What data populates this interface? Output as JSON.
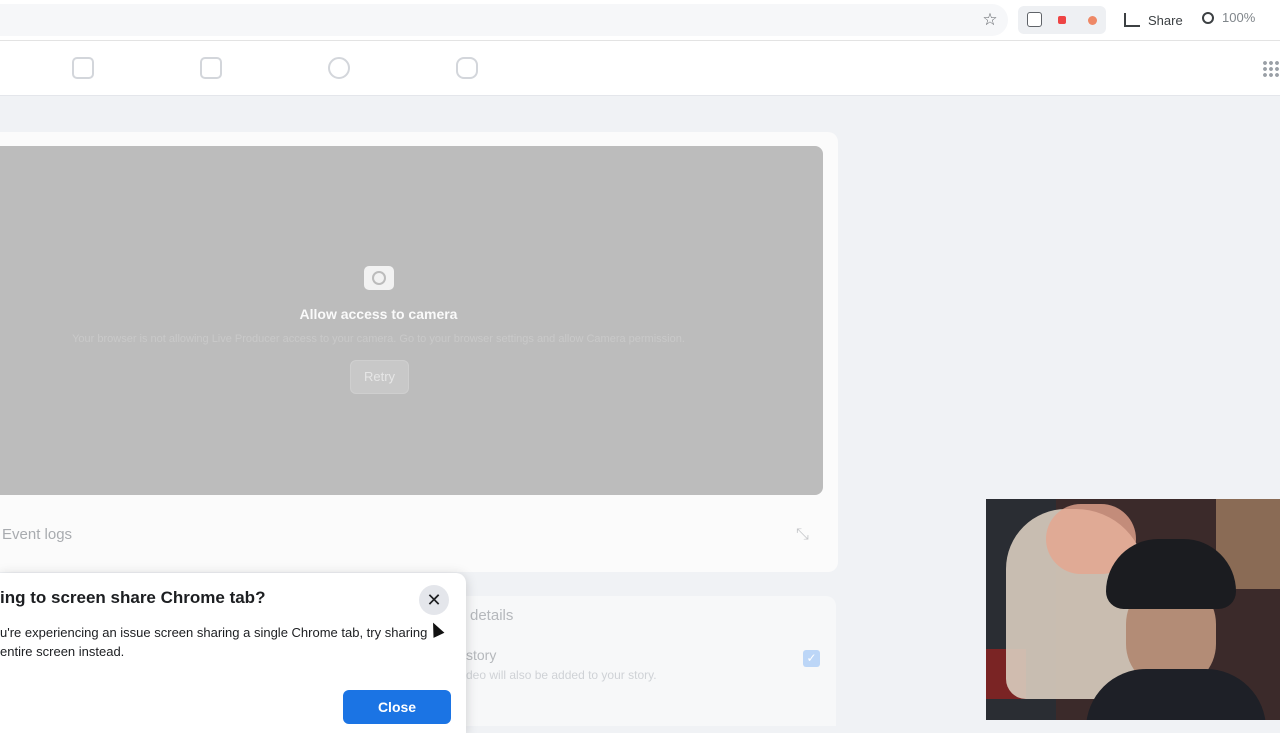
{
  "browser": {
    "share_label": "Share",
    "zoom_level": "100%"
  },
  "camera": {
    "title": "Allow access to camera",
    "message": "Your browser is not allowing Live Producer access to your camera. Go to your browser settings and allow Camera permission.",
    "retry_label": "Retry"
  },
  "event_logs": {
    "label": "Event logs"
  },
  "details": {
    "heading": "details",
    "story_label": "story",
    "story_sub": "deo will also be added to your story."
  },
  "dialog": {
    "title": "ing to screen share Chrome tab?",
    "body_line1": "u're experiencing an issue screen sharing a single Chrome tab, try sharing",
    "body_line2": "entire screen instead.",
    "close_label": "Close"
  }
}
